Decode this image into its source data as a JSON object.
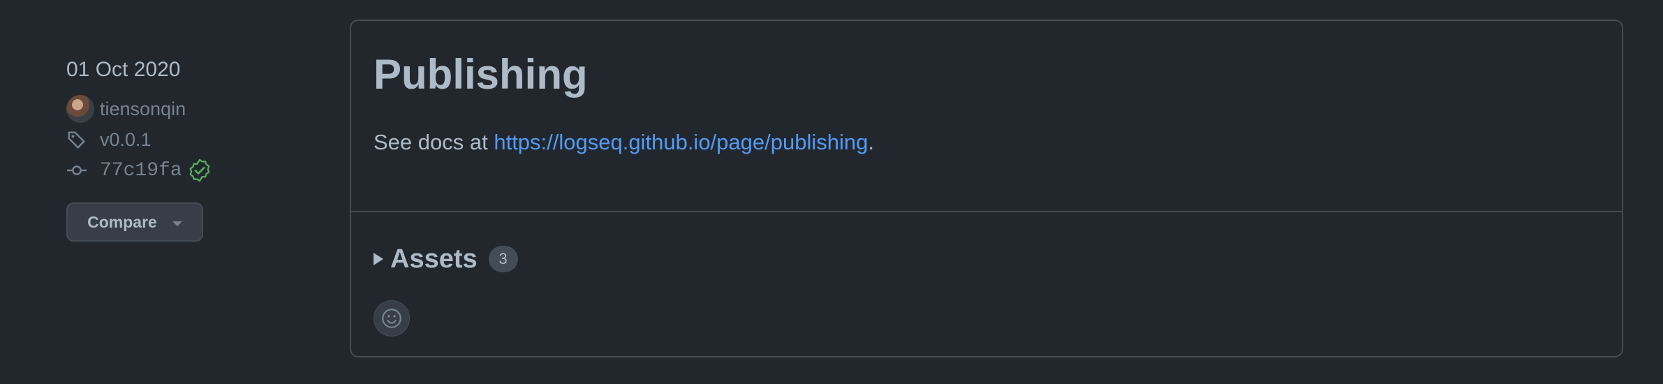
{
  "release": {
    "date": "01 Oct 2020",
    "author": "tiensonqin",
    "tag": "v0.0.1",
    "commit": "77c19fa",
    "compare_label": "Compare",
    "title": "Publishing",
    "description_prefix": "See docs at ",
    "description_link": "https://logseq.github.io/page/publishing",
    "description_suffix": ".",
    "assets_label": "Assets",
    "assets_count": "3"
  },
  "colors": {
    "background": "#22272e",
    "border": "#444c56",
    "text": "#adbac7",
    "muted": "#768390",
    "link": "#539bf5",
    "verified": "#57ab5a"
  },
  "icons": {
    "tag": "tag-icon",
    "commit": "git-commit-icon",
    "verified": "verified-badge-icon",
    "caret": "caret-down-icon",
    "disclosure": "triangle-right-icon",
    "reaction": "smiley-icon"
  }
}
